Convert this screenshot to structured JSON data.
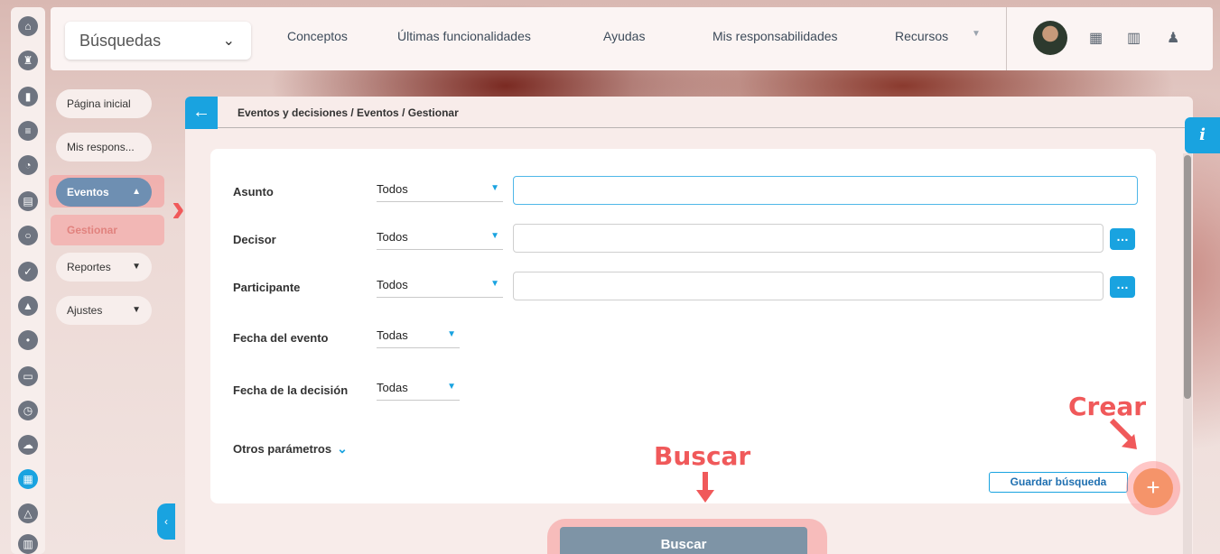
{
  "topbar": {
    "search_label": "Búsquedas",
    "nav": [
      "Conceptos",
      "Últimas funcionalidades",
      "Ayudas",
      "Mis responsabilidades",
      "Recursos"
    ],
    "icons": [
      "calendar-icon",
      "books-icon",
      "bell-icon"
    ]
  },
  "iconbar": [
    "home-icon",
    "chess-icon",
    "chart-icon",
    "list-icon",
    "pie-icon",
    "document-icon",
    "cycle-icon",
    "check-icon",
    "warning-icon",
    "connect-icon",
    "presentation-icon",
    "clock-icon",
    "cloud-icon",
    "calendar-icon",
    "network-icon",
    "form-icon"
  ],
  "submenu": {
    "pagina_inicial": "Página inicial",
    "mis_respons": "Mis respons...",
    "eventos": "Eventos",
    "gestionar": "Gestionar",
    "reportes": "Reportes",
    "ajustes": "Ajustes"
  },
  "panel": {
    "breadcrumb": "Eventos y decisiones / Eventos / Gestionar"
  },
  "form": {
    "asunto": {
      "label": "Asunto",
      "select": "Todos",
      "value": ""
    },
    "decisor": {
      "label": "Decisor",
      "select": "Todos",
      "value": ""
    },
    "participante": {
      "label": "Participante",
      "select": "Todos",
      "value": ""
    },
    "fecha_evento": {
      "label": "Fecha del evento",
      "select": "Todas"
    },
    "fecha_decision": {
      "label": "Fecha de la decisión",
      "select": "Todas"
    },
    "otros": "Otros parámetros",
    "guardar": "Guardar búsqueda",
    "buscar": "Buscar"
  },
  "annotations": {
    "crear": "Crear",
    "buscar": "Buscar"
  },
  "colors": {
    "accent": "#19a3e0",
    "annotation": "#f0595a"
  }
}
